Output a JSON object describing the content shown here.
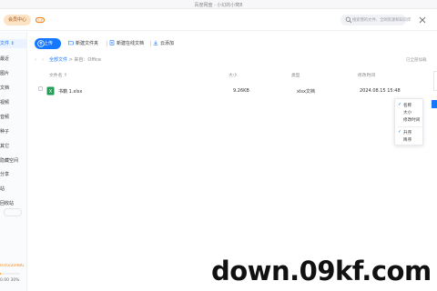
{
  "window": {
    "title": "百度网盘 · 小幻的小窝8"
  },
  "header": {
    "member_label": "会员中心",
    "search_placeholder": "搜索我的文件、全网资源和知识库"
  },
  "sidebar": {
    "items": [
      {
        "label": "文件 ⇕",
        "active": true
      },
      {
        "label": "最近"
      },
      {
        "label": "图片"
      },
      {
        "label": "文档"
      },
      {
        "label": "视频"
      },
      {
        "label": "音频"
      },
      {
        "label": "种子"
      },
      {
        "label": "其它"
      },
      {
        "label": "隐藏空间"
      },
      {
        "label": "分享"
      },
      {
        "label": "站"
      },
      {
        "label": "回收站"
      }
    ],
    "tag_label": "",
    "storage_text": "0.05/2048G",
    "storage_fill": 0.02,
    "speed_text": "0.00  30%"
  },
  "toolbar": {
    "upload_label": "上传",
    "new_folder_label": "新建文件夹",
    "new_doc_label": "新建在线文档",
    "cloud_add_label": "云添加"
  },
  "breadcrumb": {
    "root": "全部文件",
    "separator": " > ",
    "path": "来自：Office"
  },
  "status": {
    "loaded_text": "已全部加载"
  },
  "table": {
    "headers": {
      "name": "文件名 ↑",
      "size": "大小",
      "type": "类型",
      "modified": "修改时间"
    },
    "rows": [
      {
        "name": "书籍 1.xlsx",
        "size": "9.26KB",
        "type": "xlsx文档",
        "modified": "2024.08.15  15:48"
      }
    ]
  },
  "sort_menu": {
    "items": [
      {
        "label": "名称",
        "checked": true
      },
      {
        "label": "大小",
        "checked": false
      },
      {
        "label": "修改时间",
        "checked": false
      },
      {
        "label": "升序",
        "checked": true
      },
      {
        "label": "降序",
        "checked": false
      }
    ]
  },
  "watermark": {
    "text": "down.09kf.com"
  },
  "colors": {
    "accent": "#1677ff",
    "member": "#fde3c6",
    "excel": "#1f9d55"
  }
}
